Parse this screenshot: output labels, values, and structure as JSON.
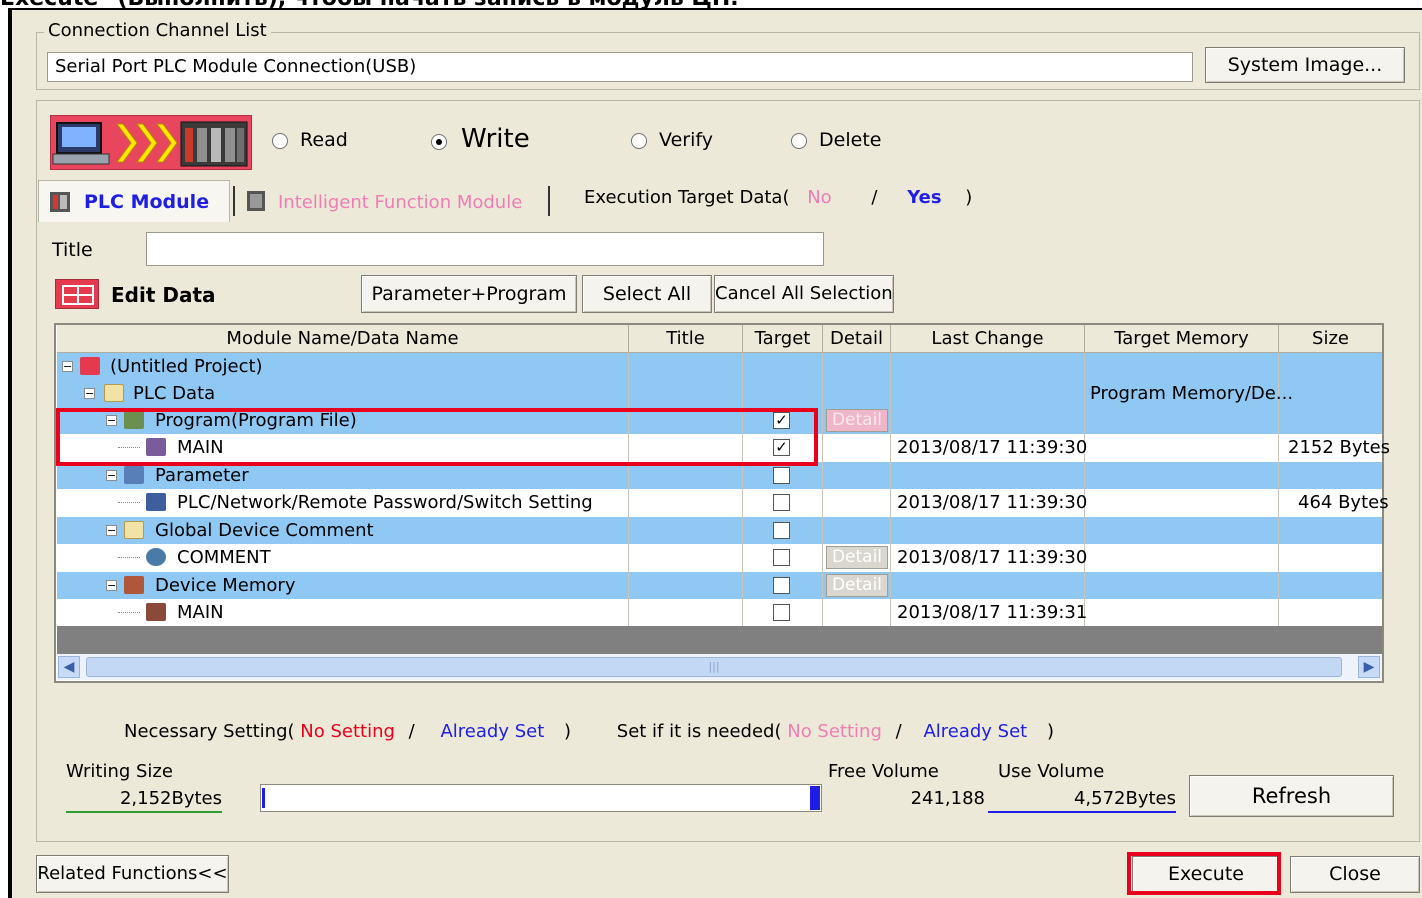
{
  "top_caption": "Execute\" (Выполнить), чтобы начать запись в модуль ЦП.",
  "connection": {
    "group_label": "Connection Channel List",
    "channel": "Serial Port  PLC Module Connection(USB)",
    "system_image_button": "System Image..."
  },
  "mode": {
    "read": "Read",
    "write": "Write",
    "verify": "Verify",
    "delete": "Delete",
    "selected": "Write"
  },
  "tabs": {
    "plc_module": "PLC Module",
    "intelligent": "Intelligent Function Module"
  },
  "execution_target": {
    "label": "Execution Target Data(",
    "no": "No",
    "slash": "/",
    "yes": "Yes",
    "close": ")"
  },
  "title_field": {
    "label": "Title",
    "value": ""
  },
  "edit_data": {
    "label": "Edit Data",
    "param_program": "Parameter+Program",
    "select_all": "Select All",
    "cancel_all": "Cancel All Selections"
  },
  "table": {
    "headers": [
      "Module Name/Data Name",
      "Title",
      "Target",
      "Detail",
      "Last Change",
      "Target Memory",
      "Size"
    ],
    "detail_label": "Detail",
    "rows": [
      {
        "name": "(Untitled Project)",
        "target_memory": "",
        "last_change": "",
        "size": ""
      },
      {
        "name": "PLC Data",
        "target_memory": "Program Memory/De...",
        "last_change": "",
        "size": ""
      },
      {
        "name": "Program(Program File)",
        "target_checked": true,
        "last_change": "",
        "size": ""
      },
      {
        "name": "MAIN",
        "target_checked": true,
        "last_change": "2013/08/17 11:39:30",
        "size": "2152 Bytes"
      },
      {
        "name": "Parameter",
        "target_checked": false,
        "last_change": "",
        "size": ""
      },
      {
        "name": "PLC/Network/Remote Password/Switch Setting",
        "target_checked": false,
        "last_change": "2013/08/17 11:39:30",
        "size": "464 Bytes"
      },
      {
        "name": "Global Device Comment",
        "target_checked": false,
        "last_change": "",
        "size": ""
      },
      {
        "name": "COMMENT",
        "target_checked": false,
        "last_change": "2013/08/17 11:39:30",
        "size": ""
      },
      {
        "name": "Device Memory",
        "target_checked": false,
        "last_change": "",
        "size": ""
      },
      {
        "name": "MAIN",
        "target_checked": false,
        "last_change": "2013/08/17 11:39:31",
        "size": ""
      }
    ]
  },
  "legend": {
    "necessary": "Necessary Setting(",
    "no_setting": "No Setting",
    "slash": "/",
    "already_set": "Already Set",
    "close": ")",
    "if_needed": "Set if it is needed(",
    "no_setting2": "No Setting",
    "already_set2": "Already Set"
  },
  "volume": {
    "writing_size_label": "Writing Size",
    "writing_size": "2,152Bytes",
    "free_volume_label": "Free Volume",
    "free_volume": "241,188",
    "use_volume_label": "Use Volume",
    "use_volume": "4,572Bytes",
    "refresh": "Refresh"
  },
  "footer": {
    "related": "Related Functions<<",
    "execute": "Execute",
    "close": "Close"
  },
  "colors": {
    "dialog_bg": "#ece9d8",
    "row_blue": "#8fc9f3",
    "highlight_red": "#e8001c",
    "link_blue": "#1e1ee6",
    "pink": "#f07cb6"
  }
}
